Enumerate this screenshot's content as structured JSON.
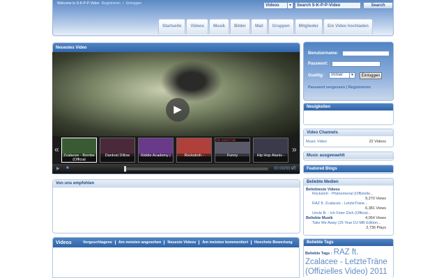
{
  "header": {
    "welcome_text": "Welcome to S-K-P-P-Video",
    "register_link": "Registrieren",
    "separator": "/",
    "login_link": "Einloggen",
    "search_scope": "Videos",
    "search_placeholder": "Search S-K-P-P-Video",
    "search_button": "Search"
  },
  "nav": [
    "Startseite",
    "Videos",
    "Musik",
    "Bilder",
    "Mail",
    "Gruppen",
    "Mitglieder",
    "Ein Video hochladen"
  ],
  "main": {
    "featured_title": "Neuestes Video",
    "recommended_title": "Von uns empfohlen",
    "thumbnails": [
      {
        "caption": "Zcalacee - Bombe (Official",
        "color": "#3a5a34"
      },
      {
        "caption": "Dankrat Dillow",
        "color": "#4a2a3a"
      },
      {
        "caption": "Kiddie Academy |",
        "color": "#6a3a8a"
      },
      {
        "caption": "Rockstroh -",
        "color": "#b0403a"
      },
      {
        "caption": "Funny",
        "color": "#5a5a6a",
        "overlay": "Sie waren hier"
      },
      {
        "caption": "Hip Hop Atanis -",
        "color": "#3a3a4a"
      }
    ],
    "time": "00:00/00:00",
    "progress": 0
  },
  "login": {
    "username_label": "Benutzername:",
    "password_label": "Passwort:",
    "valid_label": "Gueltig:",
    "valid_value": "Immer",
    "login_button": "Einloggen",
    "forgot_link": "Passwort vergessen",
    "register_link": "Registrieren"
  },
  "sidebar": {
    "news_title": "Neuigkeiten",
    "channels_title": "Video Channels",
    "channel": {
      "name": "Music Video",
      "count": "22 Videos"
    },
    "music_title": "Music ausgewaehlt",
    "blogs_title": "Featured Blogs",
    "media_title": "Beliebte Medien",
    "popular_videos_label": "Beliebteste Videos",
    "popular_videos": [
      {
        "title": "Rockstoh - Phänomenal (Offizielle...",
        "views": "9,270 Views"
      },
      {
        "title": "RAZ ft. Zcalacee - LetzteTräne...",
        "views": "6,381 Views"
      },
      {
        "title": "Uncle B. - Ich Feier Dich (Official...",
        "views": "4,054 Views"
      }
    ],
    "popular_music_label": "Beliebte Musik",
    "popular_music": [
      {
        "title": "Take Me Away (25 Year DJ-MB Edition...",
        "views": "2,736 Plays"
      }
    ],
    "tags_title": "Beliebte Tags",
    "tags_label": "Beliebte Tags :",
    "tags_text": "RAZ ft. Zcalacee - LetzteTräne (Offizielles Video) 2011"
  },
  "bottom": {
    "title": "Videos",
    "tabs": [
      "Vorgeschlagene",
      "Am meisten angesehen",
      "Neueste Videos",
      "Am meisten kommentiert",
      "Hoechste Bewertung"
    ]
  },
  "colors": {
    "accent": "#2f64a8",
    "link": "#3a6fb4"
  }
}
